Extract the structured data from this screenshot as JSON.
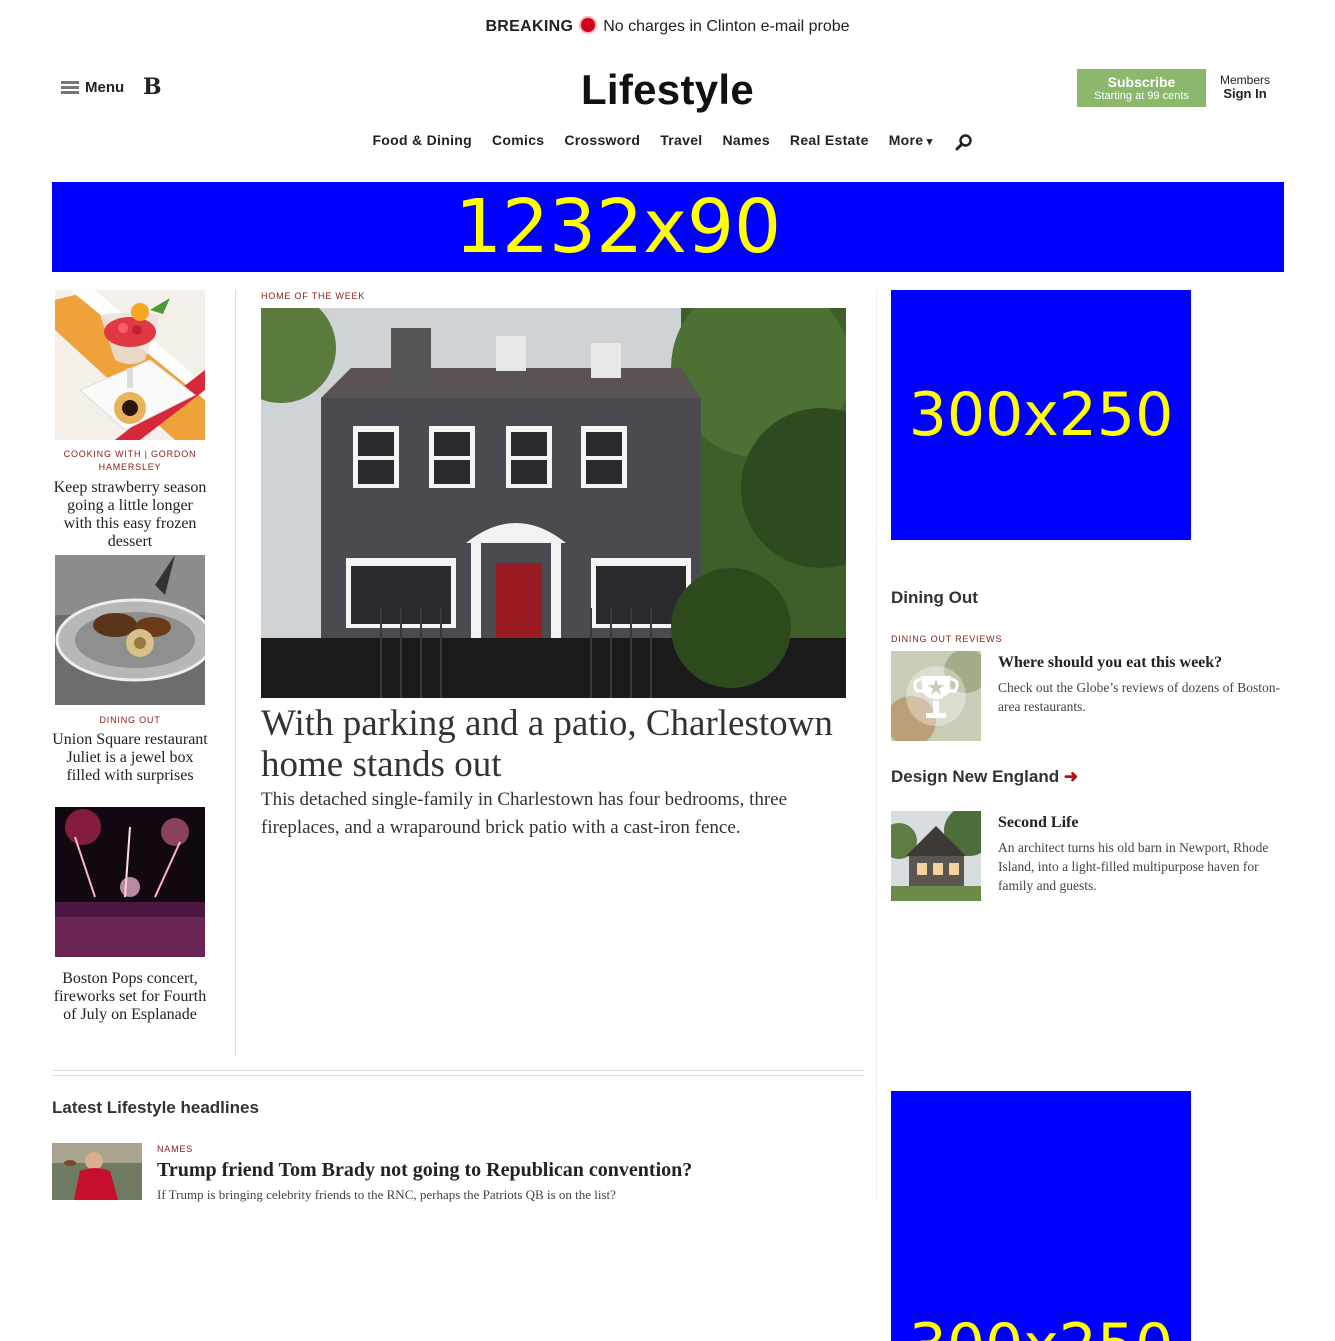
{
  "breaking": {
    "label": "BREAKING",
    "text": "No charges in Clinton e-mail probe"
  },
  "header": {
    "menu_label": "Menu",
    "logo_letter": "B",
    "section_title": "Lifestyle",
    "subscribe": {
      "label": "Subscribe",
      "sub": "Starting at 99 cents"
    },
    "signin": {
      "line1": "Members",
      "line2": "Sign In"
    }
  },
  "nav": {
    "items": [
      "Food & Dining",
      "Comics",
      "Crossword",
      "Travel",
      "Names",
      "Real Estate"
    ],
    "more_label": "More"
  },
  "ads": {
    "top": "1232x90",
    "right1": "300x250",
    "right2": "300x250"
  },
  "left_stories": [
    {
      "kicker": "COOKING WITH | GORDON HAMERSLEY",
      "headline": "Keep strawberry season going a little longer with this easy frozen dessert"
    },
    {
      "kicker": "DINING OUT",
      "headline": "Union Square restaurant Juliet is a jewel box filled with surprises"
    },
    {
      "kicker": "",
      "headline": "Boston Pops concert, fireworks set for Fourth of July on Esplanade"
    }
  ],
  "main_story": {
    "kicker": "HOME OF THE WEEK",
    "headline": "With parking and a patio, Charlestown home stands out",
    "dek": "This detached single-family in Charlestown has four bedrooms, three fireplaces, and a wraparound brick patio with a cast-iron fence."
  },
  "latest": {
    "title": "Latest Lifestyle headlines",
    "kicker": "NAMES",
    "headline": "Trump friend Tom Brady not going to Republican convention?",
    "dek": "If Trump is bringing celebrity friends to the RNC, perhaps the Patriots QB is on the list?"
  },
  "dining_out": {
    "title": "Dining Out",
    "kicker": "DINING OUT REVIEWS",
    "headline": "Where should you eat this week?",
    "dek": "Check out the Globe’s reviews of dozens of Boston-area restaurants."
  },
  "design": {
    "title": "Design New England",
    "headline": "Second Life",
    "dek": "An architect turns his old barn in Newport, Rhode Island, into a light-filled multipurpose haven for family and guests."
  },
  "colors": {
    "accent": "#8a1a1a",
    "subscribe": "#8cb86d",
    "breaking_dot": "#d0021b",
    "ad_bg": "#0000ff",
    "ad_text": "#ffff00"
  }
}
